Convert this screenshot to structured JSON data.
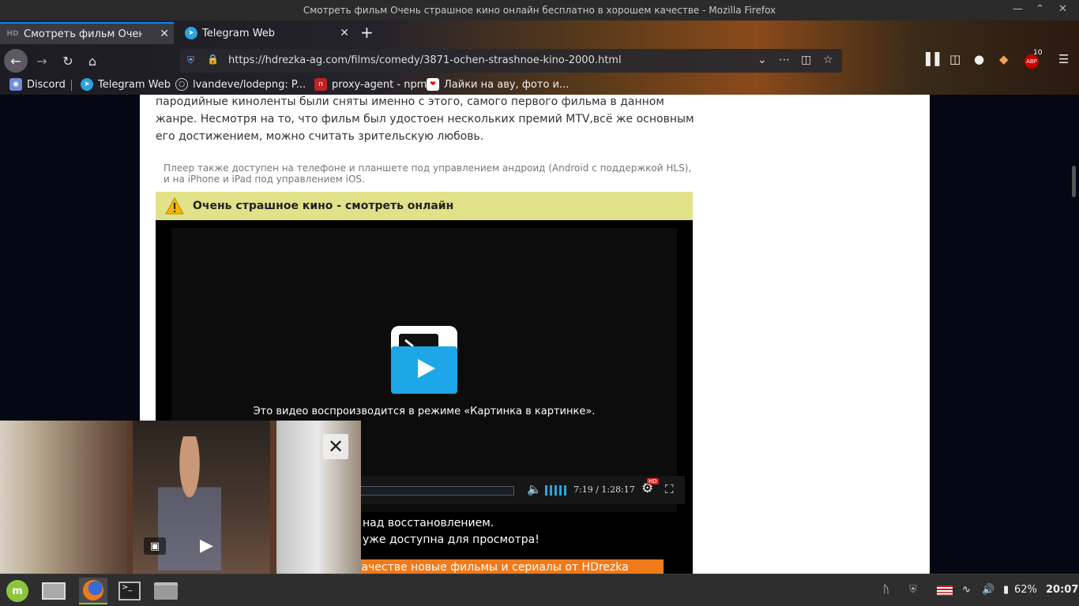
{
  "window": {
    "title": "Смотреть фильм Очень страшное кино онлайн бесплатно в хорошем качестве - Mozilla Firefox"
  },
  "tabs": [
    {
      "label": "Смотреть фильм Очень",
      "favicon": "HD"
    },
    {
      "label": "Telegram Web"
    }
  ],
  "navbar": {
    "url": "https://hdrezka-ag.com/films/comedy/3871-ochen-strashnoe-kino-2000.html",
    "abp_count": "10",
    "abp_label": "ABP"
  },
  "bookmarks": [
    {
      "label": "Discord"
    },
    {
      "label": "Telegram Web"
    },
    {
      "label": "lvandeve/lodepng: P..."
    },
    {
      "label": "proxy-agent - npm"
    },
    {
      "label": "Лайки на аву, фото и..."
    }
  ],
  "page": {
    "description": "пародийные киноленты были сняты именно с этого, самого первого фильма в данном жанре. Несмотря на то, что фильм был удостоен нескольких премий MTV,всё же основным его достижением, можно считать зрительскую любовь.",
    "player_note": "Плеер также доступен на телефоне и планшете под управлением андроид (Android с поддержкой HLS), и на iPhone и iPad под управлением iOS.",
    "player_title": "Очень страшное кино - смотреть онлайн",
    "pip_message": "Это видео воспроизводится в режиме «Картинка в картинке».",
    "time": "7:19 / 1:28:17",
    "hd_badge": "HD",
    "msg1": "над восстановлением.",
    "msg2": "уже доступна для просмотра!",
    "orange_text": "качестве новые фильмы и сериалы от HDrezka"
  },
  "taskbar": {
    "battery": "62%",
    "clock": "20:07"
  },
  "colors": {
    "accent": "#0a84ff",
    "warn_bar": "#e1e18a",
    "pip_blue": "#1ea7e8",
    "orange": "#f07a1a"
  }
}
